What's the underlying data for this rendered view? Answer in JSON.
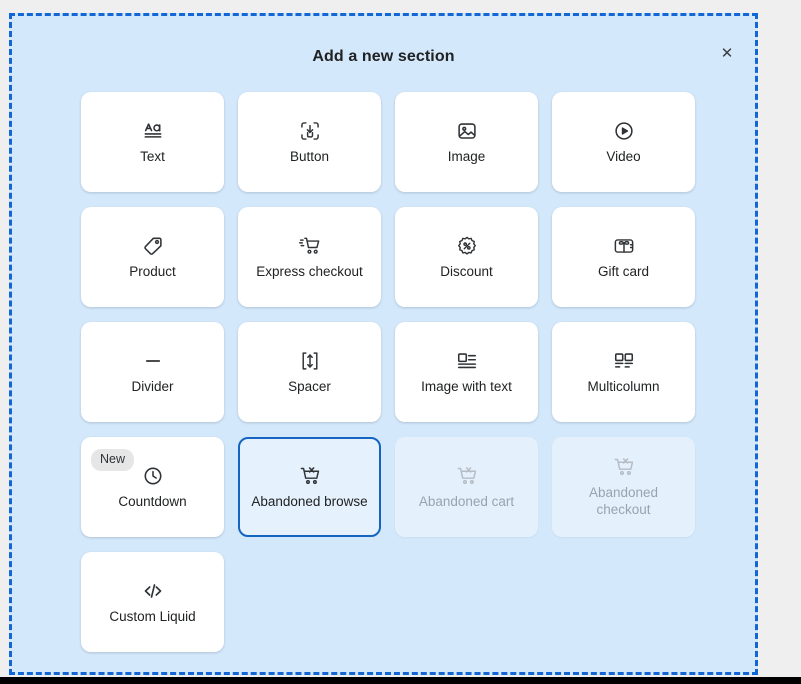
{
  "modal": {
    "title": "Add a new section",
    "close_label": "✕",
    "accent_color": "#1266d6",
    "background_color": "#d4e8fb",
    "selected_border_color": "#1565c0"
  },
  "sections": [
    {
      "label": "Text",
      "icon": "text-aa-icon",
      "state": "enabled"
    },
    {
      "label": "Button",
      "icon": "button-click-icon",
      "state": "enabled"
    },
    {
      "label": "Image",
      "icon": "image-icon",
      "state": "enabled"
    },
    {
      "label": "Video",
      "icon": "video-play-icon",
      "state": "enabled"
    },
    {
      "label": "Product",
      "icon": "product-tag-icon",
      "state": "enabled"
    },
    {
      "label": "Express checkout",
      "icon": "express-cart-icon",
      "state": "enabled"
    },
    {
      "label": "Discount",
      "icon": "discount-percent-icon",
      "state": "enabled"
    },
    {
      "label": "Gift card",
      "icon": "gift-card-icon",
      "state": "enabled"
    },
    {
      "label": "Divider",
      "icon": "divider-line-icon",
      "state": "enabled"
    },
    {
      "label": "Spacer",
      "icon": "spacer-arrows-icon",
      "state": "enabled"
    },
    {
      "label": "Image with text",
      "icon": "image-with-text-icon",
      "state": "enabled"
    },
    {
      "label": "Multicolumn",
      "icon": "multicolumn-icon",
      "state": "enabled"
    },
    {
      "label": "Countdown",
      "icon": "clock-icon",
      "state": "enabled",
      "badge": "New"
    },
    {
      "label": "Abandoned browse",
      "icon": "abandoned-cart-icon",
      "state": "selected"
    },
    {
      "label": "Abandoned cart",
      "icon": "abandoned-cart-icon",
      "state": "disabled"
    },
    {
      "label": "Abandoned checkout",
      "icon": "abandoned-cart-icon",
      "state": "disabled"
    },
    {
      "label": "Custom Liquid",
      "icon": "code-icon",
      "state": "enabled"
    }
  ]
}
